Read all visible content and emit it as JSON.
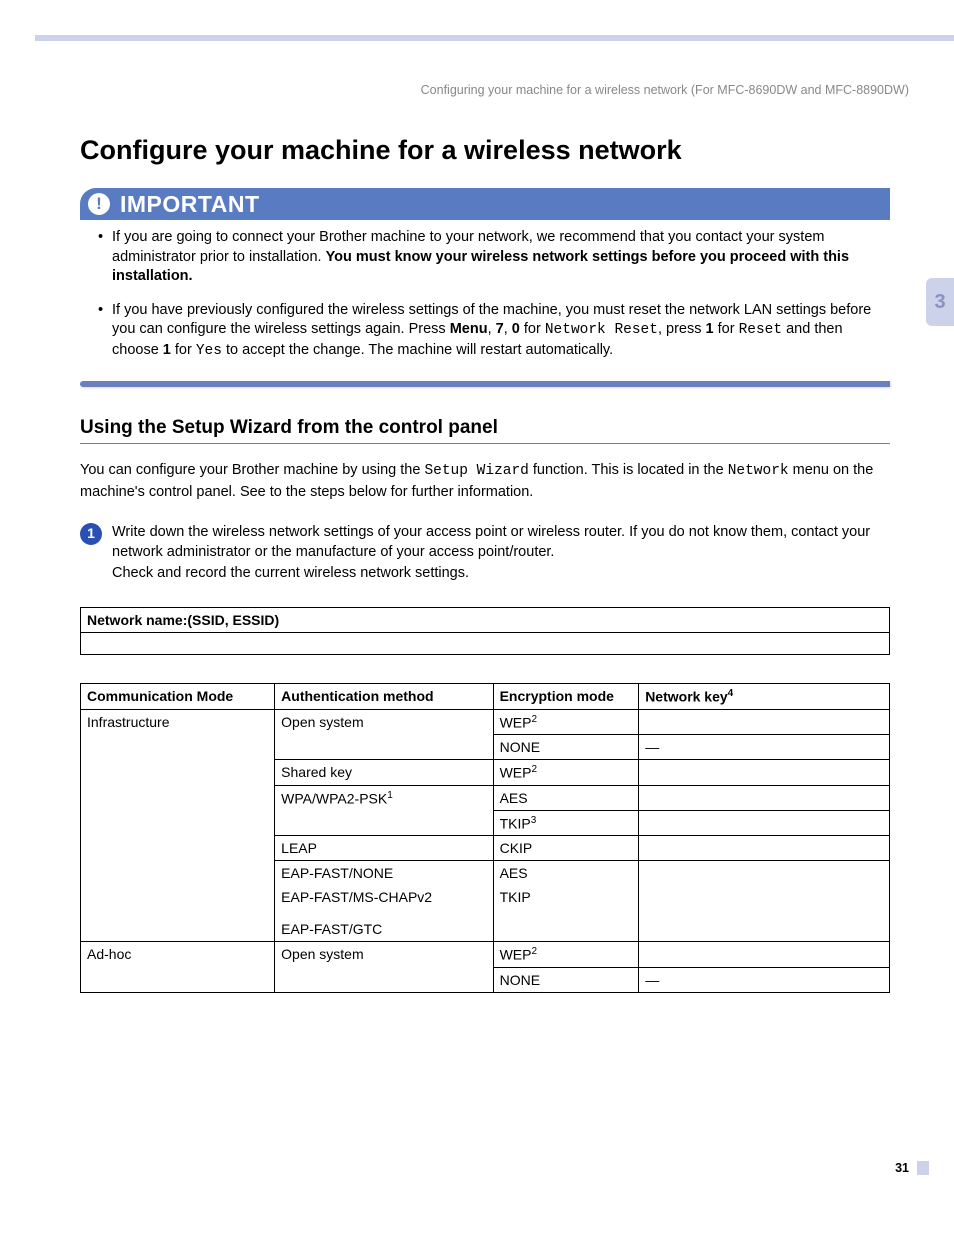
{
  "header": "Configuring your machine for a wireless network (For MFC-8690DW and MFC-8890DW)",
  "chapterTab": "3",
  "title": "Configure your machine for a wireless network",
  "importantLabel": "IMPORTANT",
  "bullet1_a": "If you are going to connect your Brother machine to your network, we recommend that you contact your system administrator prior to installation. ",
  "bullet1_b": "You must know your wireless network settings before you proceed with this installation.",
  "bullet2_a": "If you have previously configured the wireless settings of the machine, you must reset the network LAN settings before you can configure the wireless settings again. Press ",
  "menu": "Menu",
  "comma1": ", ",
  "seven": "7",
  "comma2": ", ",
  "zero": "0",
  "for1": " for ",
  "netreset": "Network Reset",
  "press1": ", press ",
  "one1": "1",
  "for2": " for ",
  "reset": "Reset",
  "andthen": " and then choose ",
  "one2": "1",
  "for3": " for ",
  "yes": "Yes",
  "bullet2_b": " to accept the change. The machine will restart automatically.",
  "h2": "Using the Setup Wizard from the control panel",
  "para_a": "You can configure your Brother machine by using the ",
  "setupwiz": "Setup Wizard",
  "para_b": " function. This is located in the ",
  "network": "Network",
  "para_c": " menu on the machine's control panel. See to the steps below for further information.",
  "step1_num": "1",
  "step1_a": "Write down the wireless network settings of your access point or wireless router. If you do not know them, contact your network administrator or the manufacture of your access point/router.",
  "step1_b": "Check and record the current wireless network settings.",
  "ssidHeader": "Network name:(SSID, ESSID)",
  "th_comm": "Communication Mode",
  "th_auth": "Authentication method",
  "th_enc": "Encryption mode",
  "th_key": "Network key",
  "th_key_sup": "4",
  "r_infra": "Infrastructure",
  "r_open": "Open system",
  "r_wep": "WEP",
  "sup2": "2",
  "r_none": "NONE",
  "dash": "—",
  "r_shared": "Shared key",
  "r_wpa": "WPA/WPA2-PSK",
  "sup1": "1",
  "r_aes": "AES",
  "r_tkip": "TKIP",
  "sup3": "3",
  "r_leap": "LEAP",
  "r_ckip": "CKIP",
  "r_eapnone": "EAP-FAST/NONE",
  "r_eapms": "EAP-FAST/MS-CHAPv2",
  "r_eapgtc": "EAP-FAST/GTC",
  "r_adhoc": "Ad-hoc",
  "pageNum": "31"
}
